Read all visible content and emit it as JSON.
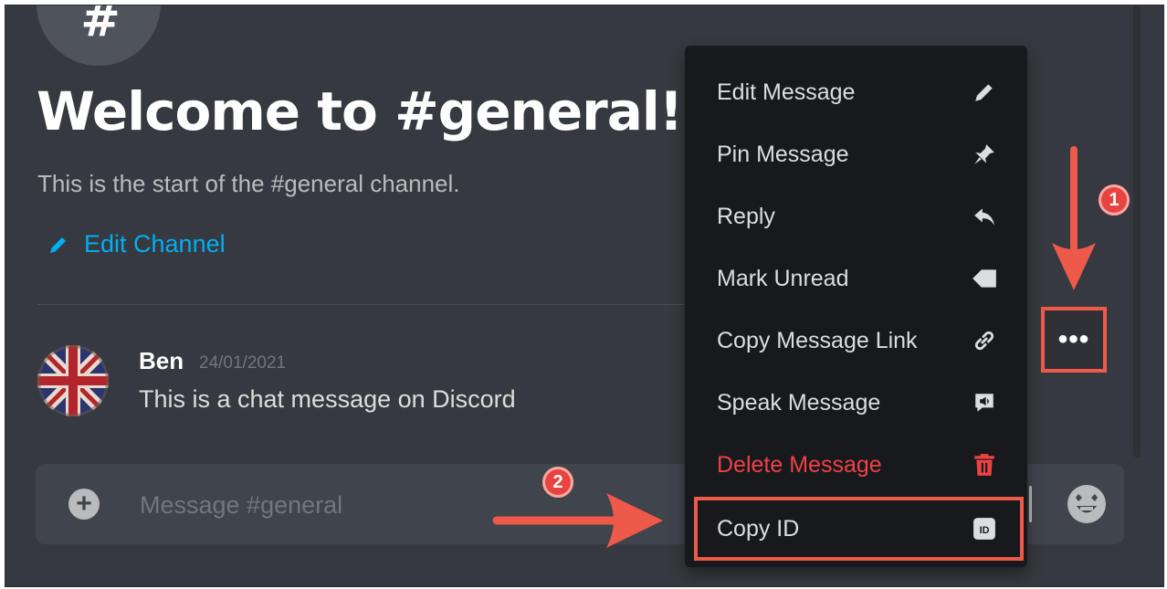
{
  "channel": {
    "icon_glyph": "#",
    "welcome_title": "Welcome to #general!",
    "welcome_subtitle": "This is the start of the #general channel.",
    "edit_channel_label": "Edit Channel"
  },
  "message": {
    "author": "Ben",
    "timestamp": "24/01/2021",
    "text": "This is a chat message on Discord",
    "avatar": "union-jack-avatar"
  },
  "composer": {
    "placeholder": "Message #general",
    "add_icon": "plus-icon",
    "emoji_icon": "emoji-icon"
  },
  "more_button": {
    "label": "•••"
  },
  "context_menu": {
    "items": [
      {
        "label": "Edit Message",
        "icon": "pencil-icon"
      },
      {
        "label": "Pin Message",
        "icon": "pin-icon"
      },
      {
        "label": "Reply",
        "icon": "reply-icon"
      },
      {
        "label": "Mark Unread",
        "icon": "mark-unread-icon"
      },
      {
        "label": "Copy Message Link",
        "icon": "link-icon"
      },
      {
        "label": "Speak Message",
        "icon": "speak-icon"
      },
      {
        "label": "Delete Message",
        "icon": "trash-icon"
      },
      {
        "label": "Copy ID",
        "icon": "id-icon"
      }
    ]
  },
  "annotations": {
    "step1": "1",
    "step2": "2",
    "highlight_color": "#ee5a4a"
  },
  "colors": {
    "background": "#36393f",
    "menu_background": "#18191c",
    "link_blue": "#00aff4",
    "danger_red": "#ed4245"
  }
}
